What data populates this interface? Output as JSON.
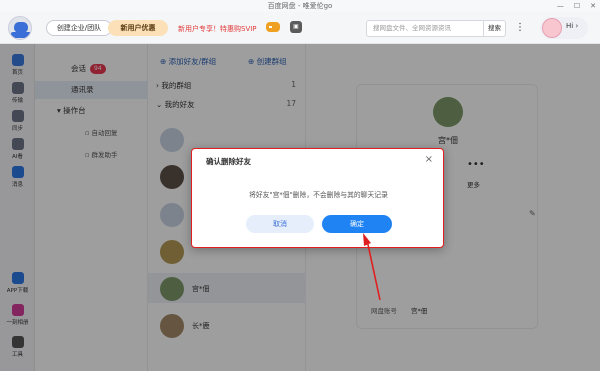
{
  "window": {
    "title": "百度网盘 - 唯爱伦go"
  },
  "topbar": {
    "enterprise_label": "创建企业/团队",
    "newuser_label": "新用户优惠",
    "promo_text": "新用户专享！特惠购SVIP",
    "search_placeholder": "搜网盘文件、全网资源资讯",
    "search_button": "搜索",
    "more_label": "⋮",
    "greeting": "Hi",
    "logo_text": "百度网盘"
  },
  "sidebar": {
    "items": [
      {
        "label": "首页",
        "icon": "home-icon"
      },
      {
        "label": "传输",
        "icon": "transfer-icon"
      },
      {
        "label": "同步",
        "icon": "sync-icon"
      },
      {
        "label": "AI看",
        "icon": "ai-icon"
      },
      {
        "label": "消息",
        "icon": "message-icon"
      }
    ],
    "bottom_items": [
      {
        "label": "APP下载",
        "icon": "app-download-icon"
      },
      {
        "label": "一刻相册",
        "icon": "album-icon"
      },
      {
        "label": "工具",
        "icon": "tools-icon"
      }
    ]
  },
  "panel": {
    "session_label": "会话",
    "session_badge": "94",
    "contacts_label": "通讯录",
    "console_label": "操作台",
    "auto_reply_label": "自动回复",
    "group_helper_label": "群发助手"
  },
  "contacts": {
    "add_friend": "添加好友/群组",
    "create_group": "创建群组",
    "groups": [
      {
        "label": "我的群组",
        "count": "1"
      },
      {
        "label": "我的好友",
        "count": "17"
      }
    ],
    "rows": [
      {
        "name": ""
      },
      {
        "name": ""
      },
      {
        "name": ""
      },
      {
        "name": ""
      },
      {
        "name": "宫*佃"
      },
      {
        "name": "长*鹿"
      }
    ]
  },
  "detail": {
    "name": "宫*佃",
    "more_label": "更多",
    "delete_label": "删",
    "account_label": "网盘账号",
    "account_value": "宫*佃"
  },
  "dialog": {
    "title": "确认删除好友",
    "message": "将好友\"宫*佃\"删除，不会删除与其的聊天记录",
    "cancel": "取消",
    "confirm": "确定",
    "close": "×"
  },
  "colors": {
    "accent": "#1f83f3",
    "highlight_border": "#e02020",
    "badge": "#e8384f"
  }
}
